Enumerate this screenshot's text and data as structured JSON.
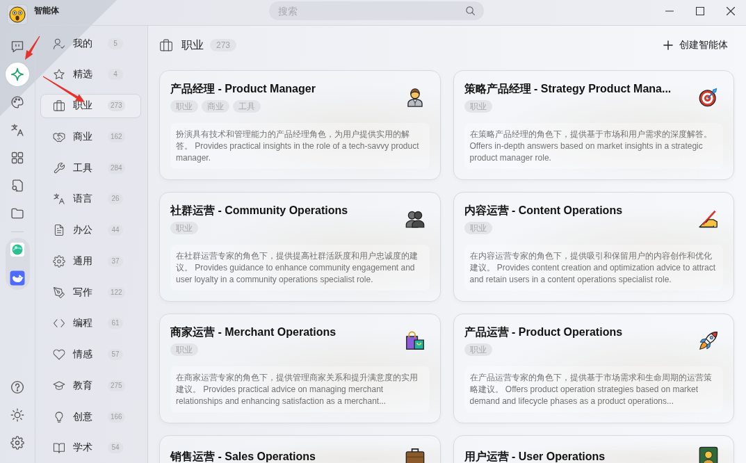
{
  "app": {
    "title": "智能体"
  },
  "rail": {
    "items": [
      {
        "selected": false
      },
      {
        "selected": true
      },
      {
        "selected": false
      },
      {
        "selected": false
      },
      {
        "selected": false
      },
      {
        "selected": false
      },
      {
        "selected": false
      }
    ]
  },
  "search": {
    "placeholder": "搜索"
  },
  "categories": [
    {
      "label": "我的",
      "count": "5",
      "selected": false
    },
    {
      "label": "精选",
      "count": "4",
      "selected": false
    },
    {
      "label": "职业",
      "count": "273",
      "selected": true
    },
    {
      "label": "商业",
      "count": "162",
      "selected": false
    },
    {
      "label": "工具",
      "count": "284",
      "selected": false
    },
    {
      "label": "语言",
      "count": "26",
      "selected": false
    },
    {
      "label": "办公",
      "count": "44",
      "selected": false
    },
    {
      "label": "通用",
      "count": "37",
      "selected": false
    },
    {
      "label": "写作",
      "count": "122",
      "selected": false
    },
    {
      "label": "编程",
      "count": "61",
      "selected": false
    },
    {
      "label": "情感",
      "count": "57",
      "selected": false
    },
    {
      "label": "教育",
      "count": "275",
      "selected": false
    },
    {
      "label": "创意",
      "count": "166",
      "selected": false
    },
    {
      "label": "学术",
      "count": "54",
      "selected": false
    }
  ],
  "header": {
    "title": "职业",
    "count": "273"
  },
  "create_button": {
    "label": "创建智能体"
  },
  "cards": [
    {
      "title": "产品经理 - Product Manager",
      "tags": [
        "职业",
        "商业",
        "工具"
      ],
      "description": "扮演具有技术和管理能力的产品经理角色，为用户提供实用的解答。 Provides practical insights in the role of a tech-savvy product manager."
    },
    {
      "title": "策略产品经理 - Strategy Product Mana...",
      "tags": [
        "职业"
      ],
      "description": "在策略产品经理的角色下，提供基于市场和用户需求的深度解答。 Offers in-depth answers based on market insights in a strategic product manager role."
    },
    {
      "title": "社群运营 - Community Operations",
      "tags": [
        "职业"
      ],
      "description": "在社群运营专家的角色下，提供提高社群活跃度和用户忠诚度的建议。 Provides guidance to enhance community engagement and user loyalty in a community operations specialist role."
    },
    {
      "title": "内容运营 - Content Operations",
      "tags": [
        "职业"
      ],
      "description": "在内容运营专家的角色下，提供吸引和保留用户的内容创作和优化建议。 Provides content creation and optimization advice to attract and retain users in a content operations specialist role."
    },
    {
      "title": "商家运营 - Merchant Operations",
      "tags": [
        "职业"
      ],
      "description": "在商家运营专家的角色下，提供管理商家关系和提升满意度的实用建议。 Provides practical advice on managing merchant relationships and enhancing satisfaction as a merchant..."
    },
    {
      "title": "产品运营 - Product Operations",
      "tags": [
        "职业"
      ],
      "description": "在产品运营专家的角色下，提供基于市场需求和生命周期的运营策略建议。 Offers product operation strategies based on market demand and lifecycle phases as a product operations..."
    },
    {
      "title": "销售运营 - Sales Operations"
    },
    {
      "title": "用户运营 - User Operations"
    }
  ]
}
